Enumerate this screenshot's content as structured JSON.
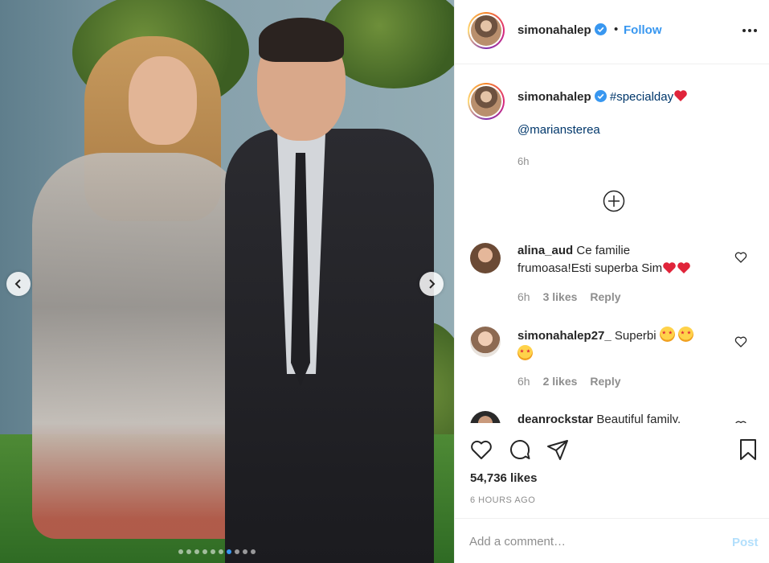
{
  "post": {
    "author": "simonahalep",
    "follow_label": "Follow",
    "separator": "•"
  },
  "caption": {
    "username": "simonahalep",
    "hashtag": "#specialday",
    "mention": "@mariansterea",
    "time": "6h"
  },
  "comments": [
    {
      "username": "alina_aud",
      "text_line1": "Ce familie",
      "text_line2": "frumoasa!Esti superba Sim",
      "time": "6h",
      "likes": "3 likes",
      "reply": "Reply"
    },
    {
      "username": "simonahalep27_",
      "text": "Superbi",
      "time": "6h",
      "likes": "2 likes",
      "reply": "Reply"
    },
    {
      "username": "deanrockstar",
      "text": "Beautiful family."
    }
  ],
  "stats": {
    "likes": "54,736 likes",
    "time_ago": "6 HOURS AGO"
  },
  "comment_box": {
    "placeholder": "Add a comment…",
    "post_label": "Post"
  },
  "carousel": {
    "total_slides": 10,
    "active_index": 6
  },
  "colors": {
    "accent": "#3897f0",
    "link": "#00376b",
    "muted": "#8e8e8e",
    "post_disabled": "#b2dffc"
  }
}
